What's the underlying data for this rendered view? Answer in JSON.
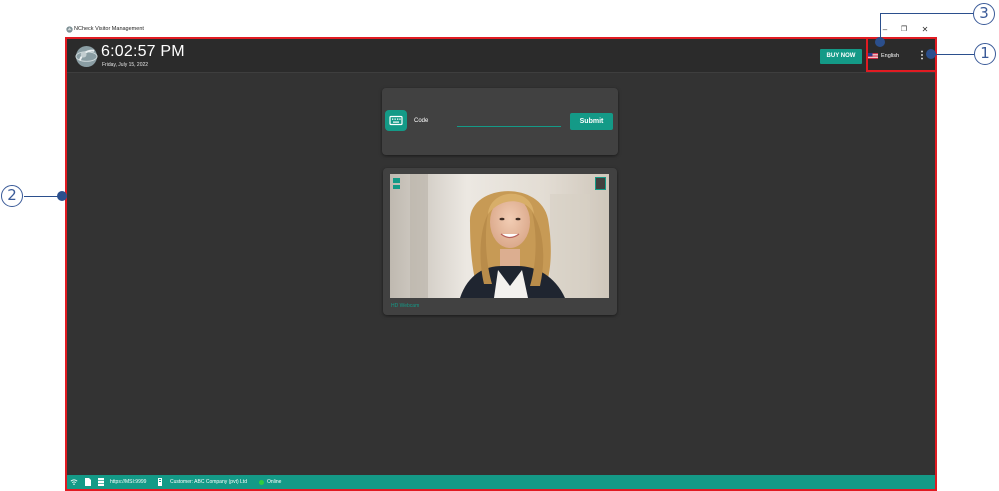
{
  "window": {
    "title": "NCheck Visitor Management",
    "minimize_glyph": "–",
    "maximize_glyph": "❐",
    "close_glyph": "✕"
  },
  "header": {
    "time": "6:02:57 PM",
    "date": "Friday, July 15, 2022",
    "buy_now_label": "BUY NOW",
    "language_label": "English",
    "language_flag": "us-flag-icon",
    "menu_glyph": "⋮"
  },
  "code_card": {
    "keyboard_icon": "keyboard-icon",
    "label": "Code",
    "input_value": "",
    "submit_label": "Submit"
  },
  "camera_card": {
    "caption": "HD Webcam"
  },
  "statusbar": {
    "server": "https://MSI:9999",
    "customer": "Customer: ABC Company (pvt) Ltd",
    "status": "Online"
  },
  "callouts": {
    "one": "1",
    "two": "2",
    "three": "3"
  },
  "colors": {
    "accent": "#149a87",
    "background": "#333333",
    "header_bg": "#2b2b2b",
    "card_bg": "#414141",
    "highlight": "#e11b22",
    "callout": "#2b4f8d",
    "online": "#2ecc40"
  }
}
